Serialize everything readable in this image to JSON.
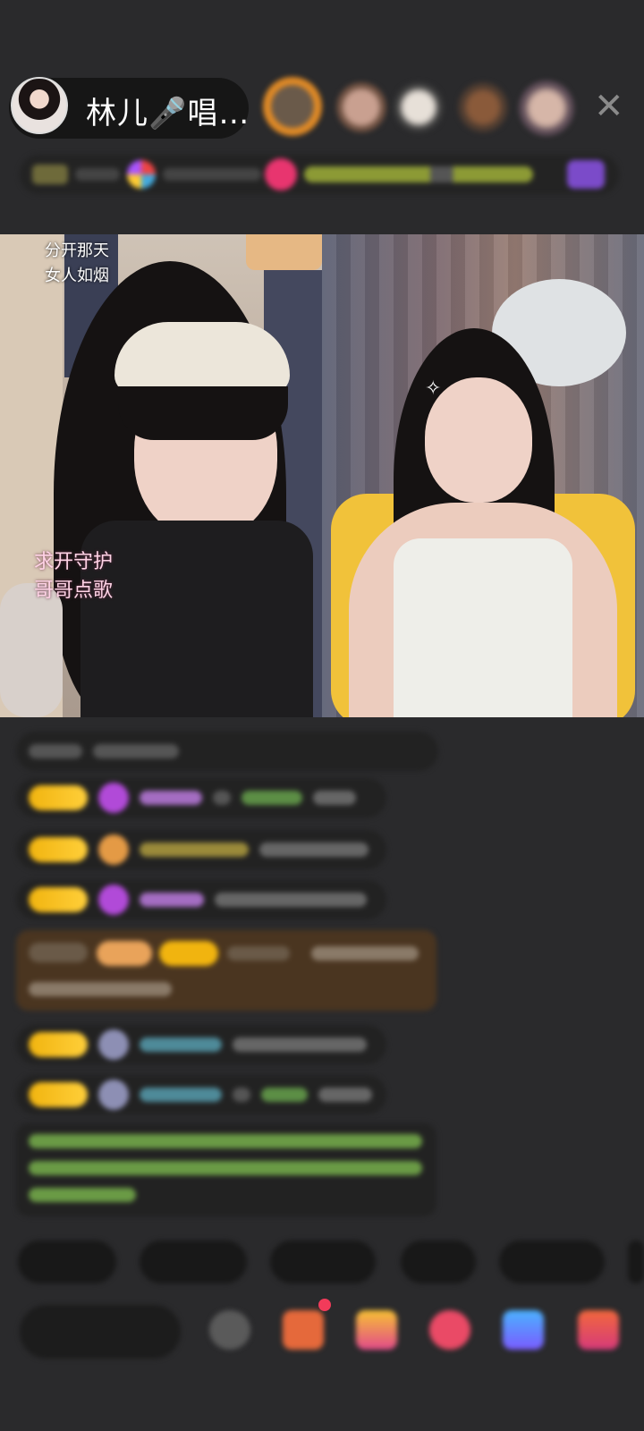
{
  "header": {
    "host_name": "林儿🎤唱…",
    "close_icon": "close-icon"
  },
  "video": {
    "left_caption_line1": "分开那天",
    "left_caption_line2": "女人如烟",
    "left_overlay_line1": "求开守护",
    "left_overlay_line2": "哥哥点歌"
  },
  "colors": {
    "badge_gold": "#f1b40f",
    "chat_bg": "#222222",
    "page_bg": "#2a2a2c"
  }
}
